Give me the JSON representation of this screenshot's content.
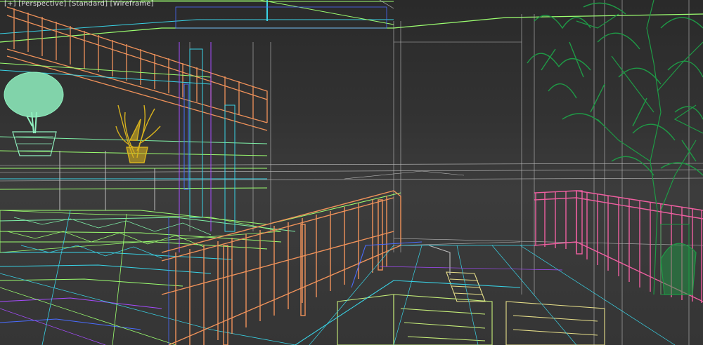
{
  "viewport": {
    "label_parts": [
      "[+]",
      "[Perspective]",
      "[Standard]",
      "[Wireframe]"
    ]
  },
  "palette": {
    "background": "#3a3a3a",
    "orange": "#f0925a",
    "pink": "#ee5fa0",
    "green_tree": "#1f9a46",
    "lime": "#9cff70",
    "cyan": "#39d3e6",
    "blue": "#4a6cff",
    "purple": "#a64cff",
    "gray_line": "#bdbdbd",
    "olive_plant": "#d7b21e",
    "mint_plant": "#8ff0bf",
    "wood": "#e8e08a"
  },
  "icons": {
    "left_potted_tree": "potted-tree-icon",
    "left_potted_plant": "potted-plant-icon",
    "right_tree": "tree-icon"
  }
}
